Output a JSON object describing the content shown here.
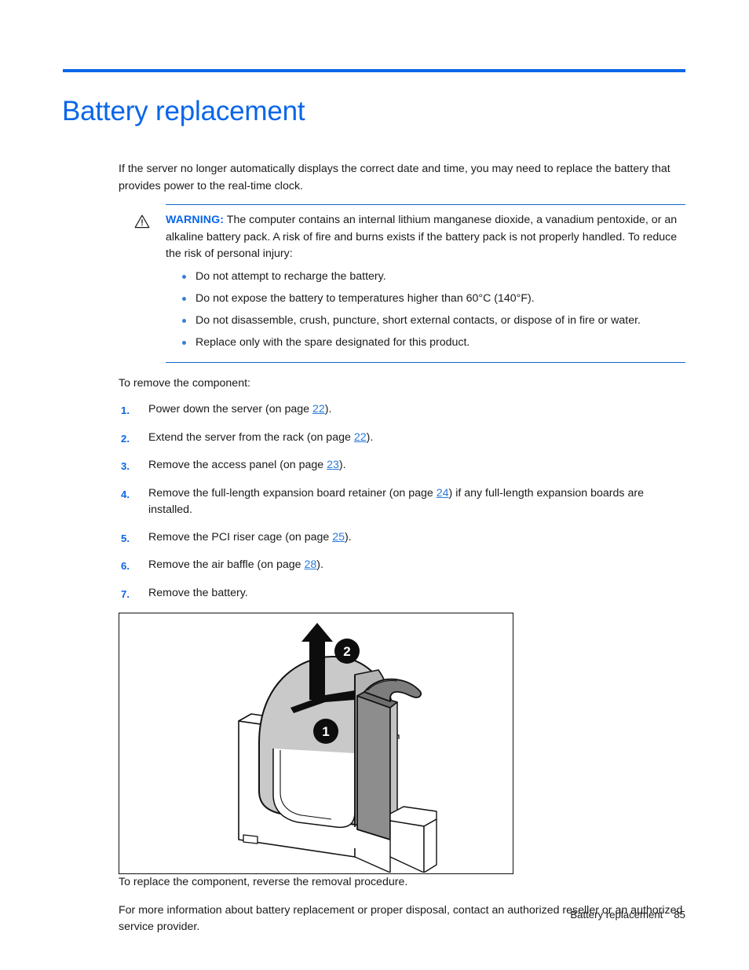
{
  "document": {
    "title": "Battery replacement",
    "accent_color": "#0a66e8",
    "rule_color": "#1367c8"
  },
  "intro": {
    "paragraph": "If the server no longer automatically displays the correct date and time, you may need to replace the battery that provides power to the real-time clock."
  },
  "warning": {
    "icon": "warning-triangle-icon",
    "label": "WARNING:",
    "text": "The computer contains an internal lithium manganese dioxide, a vanadium pentoxide, or an alkaline battery pack. A risk of fire and burns exists if the battery pack is not properly handled. To reduce the risk of personal injury:",
    "bullets": [
      "Do not attempt to recharge the battery.",
      "Do not expose the battery to temperatures higher than 60°C (140°F).",
      "Do not disassemble, crush, puncture, short external contacts, or dispose of in fire or water.",
      "Replace only with the spare designated for this product."
    ]
  },
  "procedure": {
    "lead_in": "To remove the component:",
    "steps": [
      {
        "num": "1.",
        "pre": "Power down the server (on page ",
        "xref": "22",
        "post": ")."
      },
      {
        "num": "2.",
        "pre": "Extend the server from the rack (on page ",
        "xref": "22",
        "post": ")."
      },
      {
        "num": "3.",
        "pre": "Remove the access panel (on page ",
        "xref": "23",
        "post": ")."
      },
      {
        "num": "4.",
        "pre": "Remove the full-length expansion board retainer (on page ",
        "xref": "24",
        "post": ") if any full-length expansion boards are installed."
      },
      {
        "num": "5.",
        "pre": "Remove the PCI riser cage (on page ",
        "xref": "25",
        "post": ")."
      },
      {
        "num": "6.",
        "pre": "Remove the air baffle (on page ",
        "xref": "28",
        "post": ")."
      },
      {
        "num": "7.",
        "pre": "Remove the battery.",
        "xref": "",
        "post": ""
      }
    ]
  },
  "figure": {
    "name": "battery-removal-illustration",
    "description": "Line drawing of a coin-cell battery seated in a socket on the system board, showing the retaining latch being pushed aside and the battery lifted out.",
    "callouts": [
      {
        "id": "1",
        "meaning": "push-latch-aside"
      },
      {
        "id": "2",
        "meaning": "lift-battery-out"
      }
    ]
  },
  "closing": {
    "paragraph_1": "To replace the component, reverse the removal procedure.",
    "paragraph_2": "For more information about battery replacement or proper disposal, contact an authorized reseller or an authorized service provider."
  },
  "footer": {
    "section": "Battery replacement",
    "page_number": "85"
  }
}
